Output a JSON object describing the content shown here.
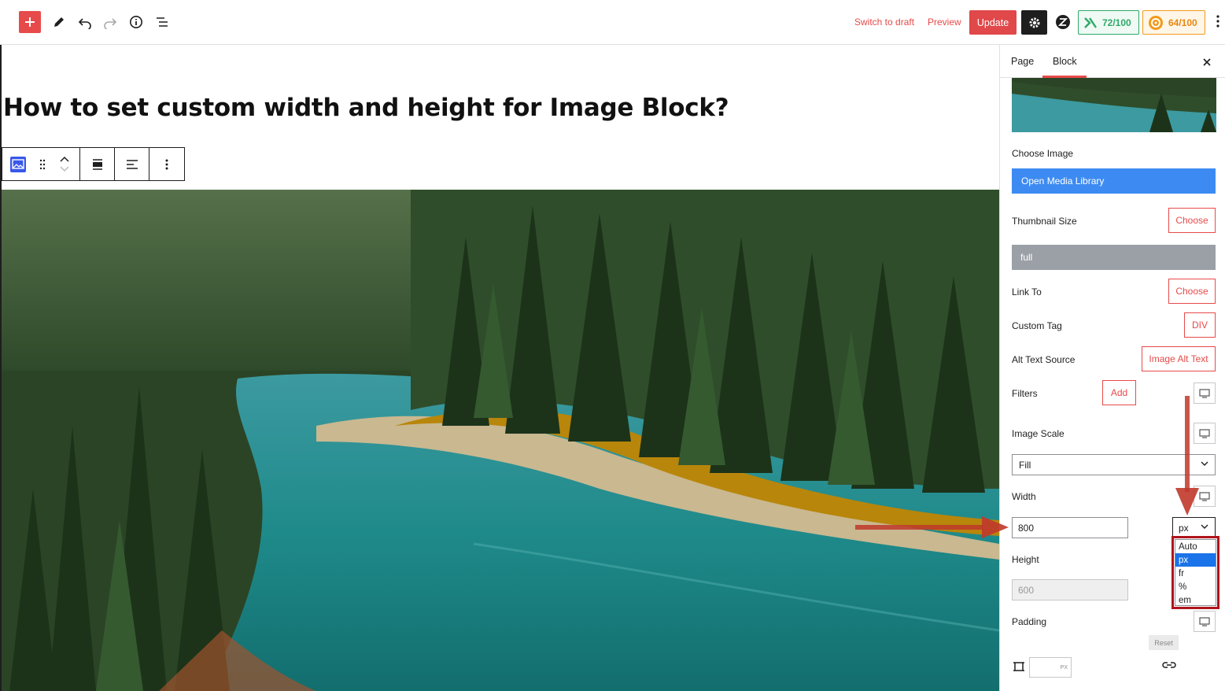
{
  "topbar": {
    "switch_to_draft": "Switch to draft",
    "preview": "Preview",
    "update": "Update",
    "score_green": "72/100",
    "score_orange": "64/100",
    "icons": [
      "plus-icon",
      "pencil-icon",
      "undo-icon",
      "redo-icon",
      "info-icon",
      "list-view-icon",
      "gear-icon",
      "z-logo-icon",
      "seo-score-icon",
      "readability-score-icon",
      "kebab-icon"
    ]
  },
  "canvas": {
    "post_title": "How to set custom width and height for Image Block?",
    "block_toolbar_icons": [
      "image-block-icon",
      "drag-handle-icon",
      "move-up-icon",
      "move-down-icon",
      "align-icon",
      "text-align-left-icon",
      "more-options-icon"
    ]
  },
  "sidebar": {
    "tabs": [
      {
        "label": "Page"
      },
      {
        "label": "Block"
      }
    ],
    "active_tab": "Block",
    "choose_image_label": "Choose Image",
    "open_media_library": "Open Media Library",
    "thumbnail_size_label": "Thumbnail Size",
    "thumbnail_size_button": "Choose",
    "thumbnail_size_value": "full",
    "link_to_label": "Link To",
    "link_to_button": "Choose",
    "custom_tag_label": "Custom Tag",
    "custom_tag_button": "DIV",
    "alt_text_label": "Alt Text Source",
    "alt_text_button": "Image Alt Text",
    "filters_label": "Filters",
    "filters_button": "Add",
    "image_scale_label": "Image Scale",
    "image_scale_value": "Fill",
    "width_label": "Width",
    "width_value": "800",
    "width_unit": "px",
    "unit_options": [
      "Auto",
      "px",
      "fr",
      "%",
      "em"
    ],
    "selected_unit": "px",
    "height_label": "Height",
    "height_value": "600",
    "padding_label": "Padding",
    "reset_label": "Reset",
    "padding_unit": "PX"
  },
  "colors": {
    "accent_red": "#e74a4a",
    "media_blue": "#3d8bf2",
    "score_green": "#2fa86a",
    "score_orange": "#f19a1a",
    "annotation_red": "#b0141b"
  }
}
